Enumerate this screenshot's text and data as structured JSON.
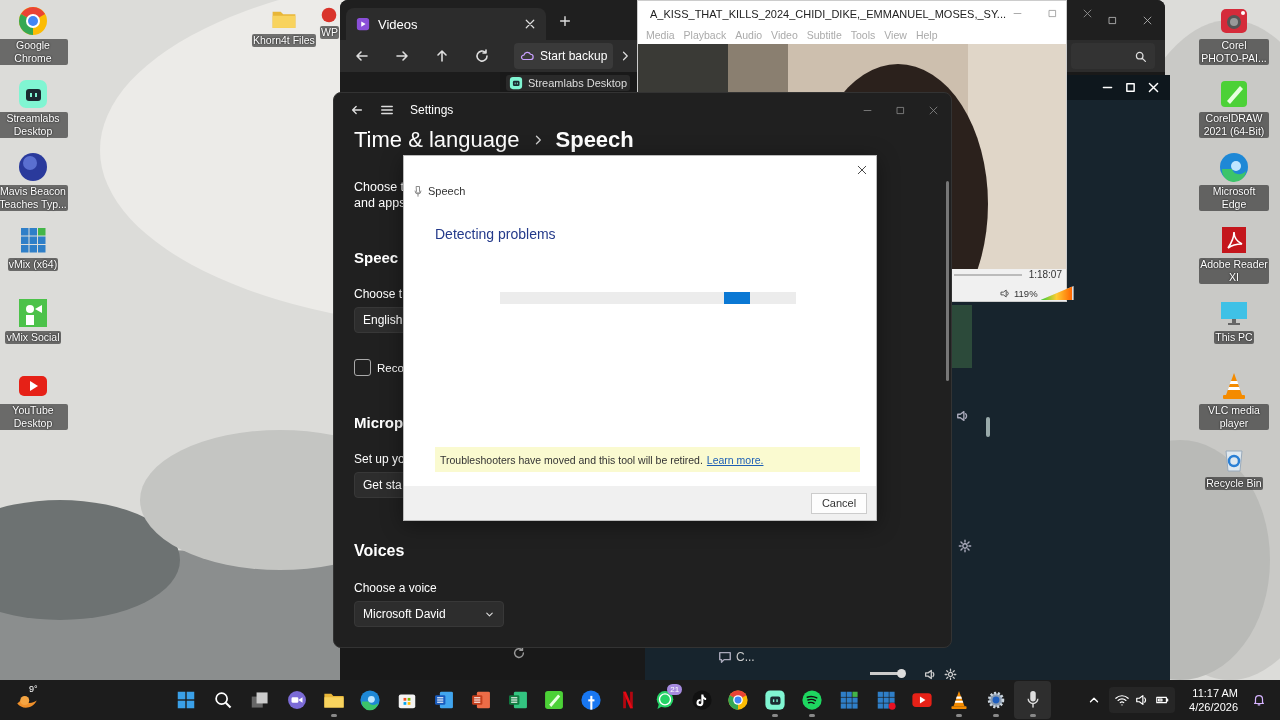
{
  "desktop": {
    "left_icons": [
      {
        "label": "Google Chrome",
        "kind": "chrome"
      },
      {
        "label": "Streamlabs Desktop",
        "kind": "streamlabs"
      },
      {
        "label": "Mavis Beacon Teaches Typ...",
        "kind": "mavis"
      },
      {
        "label": "vMix (x64)",
        "kind": "vmix"
      },
      {
        "label": "vMix Social",
        "kind": "vmixsocial"
      },
      {
        "label": "YouTube Desktop",
        "kind": "youtube"
      }
    ],
    "top_icons": [
      {
        "label": "Khorn4t Files",
        "kind": "folder"
      },
      {
        "label": "WP",
        "kind": "wp"
      }
    ],
    "right_icons": [
      {
        "label": "Corel PHOTO-PAI...",
        "kind": "corelphoto"
      },
      {
        "label": "CorelDRAW 2021 (64-Bit)",
        "kind": "coreldraw"
      },
      {
        "label": "Microsoft Edge",
        "kind": "edge"
      },
      {
        "label": "Adobe Reader XI",
        "kind": "adobe"
      },
      {
        "label": "This PC",
        "kind": "monitor"
      },
      {
        "label": "VLC media player",
        "kind": "vlc"
      },
      {
        "label": "Recycle Bin",
        "kind": "recycle"
      }
    ]
  },
  "explorer": {
    "tab": "Videos",
    "backup_button": "Start backup",
    "item": "Streamlabs Desktop"
  },
  "vlc": {
    "title": "A_KISS_THAT_KILLS_2024_CHIDI_DIKE,_EMMANUEL_MOSES,_SY...",
    "menu": [
      "Media",
      "Playback",
      "Audio",
      "Video",
      "Subtitle",
      "Tools",
      "View",
      "Help"
    ],
    "time": "1:18:07",
    "volume": "119%",
    "volume_meter": {
      "level": 0.95
    }
  },
  "streamlabs": {
    "chat_label": "C...",
    "volume_slider": {
      "level": 0.9
    }
  },
  "settings": {
    "title": "Settings",
    "breadcrumb": "Time & language",
    "page": "Speech",
    "intro": [
      "Choose t",
      "and apps"
    ],
    "speech_heading": "Speec",
    "speech_label": "Choose t",
    "language_dropdown": "English",
    "recognize_checkbox": {
      "label": "Reco",
      "checked": false
    },
    "mic_heading": "Microp",
    "mic_label": "Set up yo",
    "mic_button": "Get sta",
    "voices_heading": "Voices",
    "voice_label": "Choose a voice",
    "voice_dropdown": "Microsoft David"
  },
  "dialog": {
    "app": "Speech",
    "status": "Detecting problems",
    "progress": {
      "level": 0.845
    },
    "notice": "Troubleshooters have moved and this tool will be retired.",
    "notice_link": "Learn more.",
    "cancel": "Cancel"
  },
  "taskbar": {
    "weather": "9°",
    "apps": [
      {
        "kind": "start",
        "open": false,
        "selected": false
      },
      {
        "kind": "search",
        "open": false,
        "selected": false
      },
      {
        "kind": "taskview",
        "open": false,
        "selected": false
      },
      {
        "kind": "meet",
        "open": false,
        "selected": false
      },
      {
        "kind": "folder",
        "open": true,
        "selected": false
      },
      {
        "kind": "edge",
        "open": false,
        "selected": false
      },
      {
        "kind": "store",
        "open": false,
        "selected": false
      },
      {
        "kind": "word",
        "open": false,
        "selected": false
      },
      {
        "kind": "ppt",
        "open": false,
        "selected": false
      },
      {
        "kind": "excel",
        "open": false,
        "selected": false
      },
      {
        "kind": "coreldraw",
        "open": false,
        "selected": false
      },
      {
        "kind": "facebook",
        "open": false,
        "selected": false
      },
      {
        "kind": "netflix",
        "open": false,
        "selected": false
      },
      {
        "kind": "whatsapp",
        "open": false,
        "selected": false,
        "badge": "21"
      },
      {
        "kind": "tiktok",
        "open": false,
        "selected": false
      },
      {
        "kind": "chrome",
        "open": false,
        "selected": false
      },
      {
        "kind": "streamlabs",
        "open": true,
        "selected": false
      },
      {
        "kind": "spotify",
        "open": true,
        "selected": false
      },
      {
        "kind": "vmix",
        "open": false,
        "selected": false
      },
      {
        "kind": "vmixred",
        "open": false,
        "selected": false
      },
      {
        "kind": "youtube",
        "open": false,
        "selected": false
      },
      {
        "kind": "vlc",
        "open": true,
        "selected": false
      },
      {
        "kind": "settings",
        "open": true,
        "selected": false
      },
      {
        "kind": "mic",
        "open": true,
        "selected": true
      }
    ],
    "time": "11:17 AM",
    "date": "4/26/2026"
  }
}
